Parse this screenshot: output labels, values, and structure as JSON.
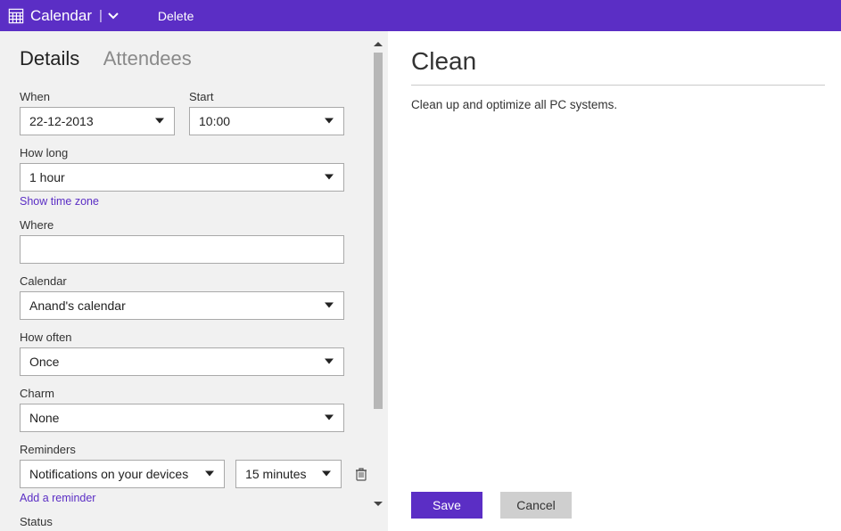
{
  "header": {
    "app_title": "Calendar",
    "delete_label": "Delete"
  },
  "tabs": {
    "details": "Details",
    "attendees": "Attendees"
  },
  "form": {
    "when": {
      "label": "When",
      "value": "22-12-2013"
    },
    "start": {
      "label": "Start",
      "value": "10:00"
    },
    "howlong": {
      "label": "How long",
      "value": "1 hour"
    },
    "show_tz": "Show time zone",
    "where": {
      "label": "Where",
      "value": ""
    },
    "calendar": {
      "label": "Calendar",
      "value": "Anand's calendar"
    },
    "howoften": {
      "label": "How often",
      "value": "Once"
    },
    "charm": {
      "label": "Charm",
      "value": "None"
    },
    "reminders": {
      "label": "Reminders",
      "type_value": "Notifications on your devices",
      "time_value": "15 minutes",
      "add_label": "Add a reminder"
    },
    "status": {
      "label": "Status"
    }
  },
  "event": {
    "title": "Clean",
    "description": "Clean up and optimize all PC systems."
  },
  "actions": {
    "save": "Save",
    "cancel": "Cancel"
  }
}
